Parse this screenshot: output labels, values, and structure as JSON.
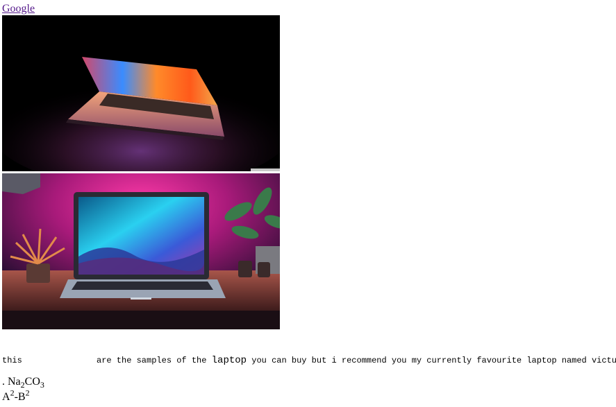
{
  "link": {
    "label": "Google"
  },
  "images": [
    {
      "name": "laptop-photo-dark",
      "colors": {
        "bg": "#000000",
        "screen_a": "#ff6a1a",
        "screen_b": "#3a8cff",
        "glow": "#c85af0"
      }
    },
    {
      "name": "laptop-photo-desk",
      "colors": {
        "wall": "#e8208c",
        "desk": "#6b3a2c",
        "screen": "#1fa8e0"
      }
    }
  ],
  "sentence": {
    "word_1": "this",
    "part_2": "are the samples of the ",
    "emphasis": "laptop",
    "part_3": " you can buy but i recommend you my currently favourite laptop named victus"
  },
  "chem": {
    "prefix": ". Na",
    "sub_1": "2",
    "middle": "CO",
    "sub_2": "3"
  },
  "algebra": {
    "a": "A",
    "a_exp": "2",
    "minus_b": "-B",
    "b_exp": "2"
  }
}
